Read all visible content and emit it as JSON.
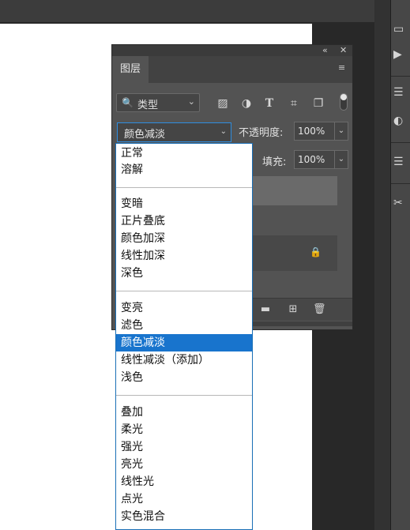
{
  "layers_panel": {
    "tab_label": "图层",
    "collapse_glyph": "«",
    "close_glyph": "✕",
    "menu_glyph": "≡",
    "filter": {
      "kind_label": "类型",
      "icons": [
        "image-filter-icon",
        "adjustment-filter-icon",
        "type-filter-icon",
        "shape-filter-icon",
        "smart-object-filter-icon"
      ]
    },
    "opacity": {
      "label": "不透明度:",
      "value": "100%"
    },
    "fill": {
      "label": "填充:",
      "value": "100%"
    },
    "bottom_icons": [
      "new-group-icon",
      "new-layer-icon",
      "delete-layer-icon"
    ]
  },
  "blend_mode": {
    "selected": "颜色减淡",
    "groups": [
      [
        "正常",
        "溶解"
      ],
      [
        "变暗",
        "正片叠底",
        "颜色加深",
        "线性加深",
        "深色"
      ],
      [
        "变亮",
        "滤色",
        "颜色减淡",
        "线性减淡（添加）",
        "浅色"
      ],
      [
        "叠加",
        "柔光",
        "强光",
        "亮光",
        "线性光",
        "点光",
        "实色混合"
      ]
    ]
  },
  "colors": {
    "panel_bg": "#535353",
    "menu_highlight": "#1874cd",
    "canvas": "#ffffff"
  }
}
